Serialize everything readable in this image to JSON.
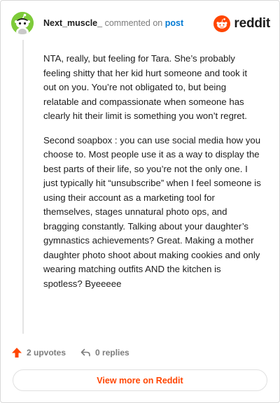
{
  "comment": {
    "username": "Next_muscle_",
    "action_text": "commented on",
    "target_text": "post",
    "paragraphs": [
      "NTA, really, but feeling for Tara. She’s probably feeling shitty that her kid hurt someone and took it out on you. You’re not obligated to, but being relatable and compassionate when someone has clearly hit their limit is something you won’t regret.",
      "Second soapbox : you can use social media how you choose to. Most people use it as a way to display the best parts of their life, so you’re not the only one. I just typically hit “unsubscribe” when I feel someone is using their account as a marketing tool for themselves, stages unnatural photo ops, and bragging constantly. Talking about your daughter’s gymnastics achievements? Great. Making a mother daughter photo shoot about making cookies and only wearing matching outfits AND the kitchen is spotless? Byeeeee"
    ]
  },
  "brand": {
    "name": "reddit",
    "accent_color": "#ff4500",
    "link_color": "#0079d3"
  },
  "actions": {
    "upvotes_label": "2 upvotes",
    "replies_label": "0 replies"
  },
  "footer": {
    "view_more_label": "View more on Reddit"
  },
  "icons": {
    "avatar": "snoo-avatar-icon",
    "logo": "reddit-logo-icon",
    "upvote": "upvote-arrow-icon",
    "reply": "reply-arrow-icon"
  }
}
